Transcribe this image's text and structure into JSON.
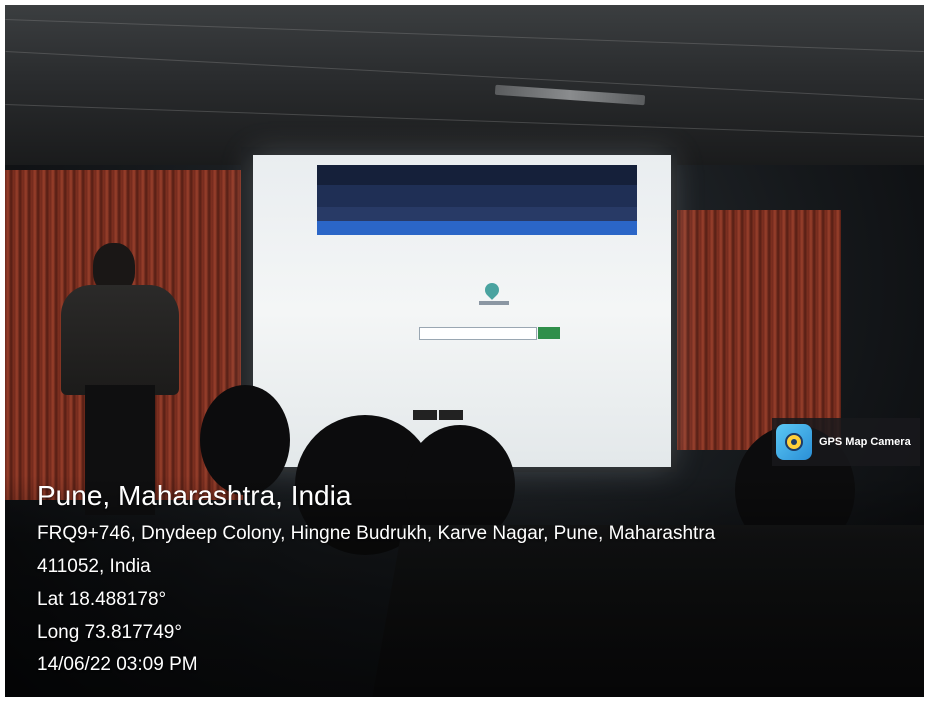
{
  "location": {
    "title": "Pune, Maharashtra, India",
    "address_line1": "FRQ9+746, Dnydeep Colony, Hingne Budrukh, Karve Nagar, Pune, Maharashtra",
    "address_line2": "411052, India",
    "latitude": "Lat 18.488178°",
    "longitude": "Long 73.817749°",
    "datetime": "14/06/22 03:09 PM"
  },
  "badge": {
    "label": "GPS Map Camera",
    "icon": "gps-map-camera-app-icon"
  },
  "colors": {
    "curtain": "#a8442d",
    "screen_nav": "#2b66c7",
    "search_button": "#2f8f4a",
    "badge_icon": "#5cc8f5"
  }
}
